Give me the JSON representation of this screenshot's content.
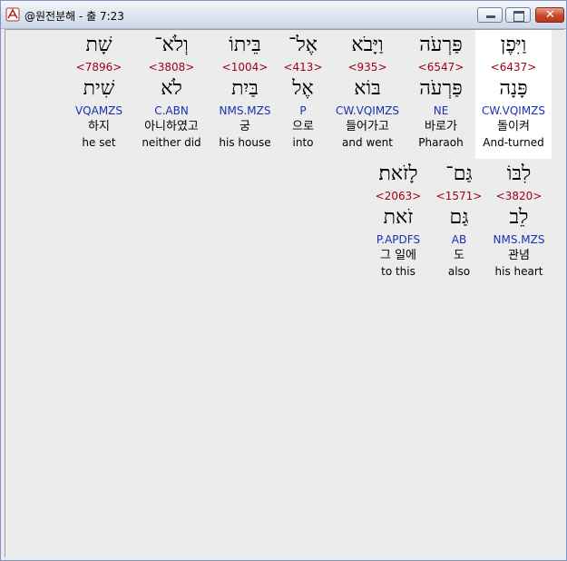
{
  "window": {
    "title": "@원전분해 - 출 7:23",
    "buttons": {
      "minimize": "minimize",
      "maximize": "maximize",
      "close": "✕"
    }
  },
  "words": [
    {
      "hebrew": "וַיִּפֶן",
      "strong": "<6437>",
      "lemma": "פָּנָה",
      "parse": "CW.VQIMZS",
      "korean": "돌이켜",
      "english": "And-turned",
      "selected": true
    },
    {
      "hebrew": "פַּרְעֹה",
      "strong": "<6547>",
      "lemma": "פַּרְעֹה",
      "parse": "NE",
      "korean": "바로가",
      "english": "Pharaoh"
    },
    {
      "hebrew": "וַיָּבֹא",
      "strong": "<935>",
      "lemma": "בּוֹא",
      "parse": "CW.VQIMZS",
      "korean": "들어가고",
      "english": "and went"
    },
    {
      "hebrew": "אֶל־",
      "strong": "<413>",
      "lemma": "אֶל",
      "parse": "P",
      "korean": "으로",
      "english": "into"
    },
    {
      "hebrew": "בֵּיתוֹ",
      "strong": "<1004>",
      "lemma": "בַּיִת",
      "parse": "NMS.MZS",
      "korean": "궁",
      "english": "his house"
    },
    {
      "hebrew": "וְלֹא־",
      "strong": "<3808>",
      "lemma": "לֹא",
      "parse": "C.ABN",
      "korean": "아니하였고",
      "english": "neither did"
    },
    {
      "hebrew": "שָׁת",
      "strong": "<7896>",
      "lemma": "שִׁית",
      "parse": "VQAMZS",
      "korean": "하지",
      "english": "he set"
    },
    {
      "hebrew": "לִבּוֹ",
      "strong": "<3820>",
      "lemma": "לֵב",
      "parse": "NMS.MZS",
      "korean": "관념",
      "english": "his heart"
    },
    {
      "hebrew": "גַּם־",
      "strong": "<1571>",
      "lemma": "גַּם",
      "parse": "AB",
      "korean": "도",
      "english": "also"
    },
    {
      "hebrew": "לָזֹאת׃",
      "strong": "<2063>",
      "lemma": "זֹאת",
      "parse": "P.APDFS",
      "korean": "그 일에",
      "english": "to this"
    }
  ]
}
